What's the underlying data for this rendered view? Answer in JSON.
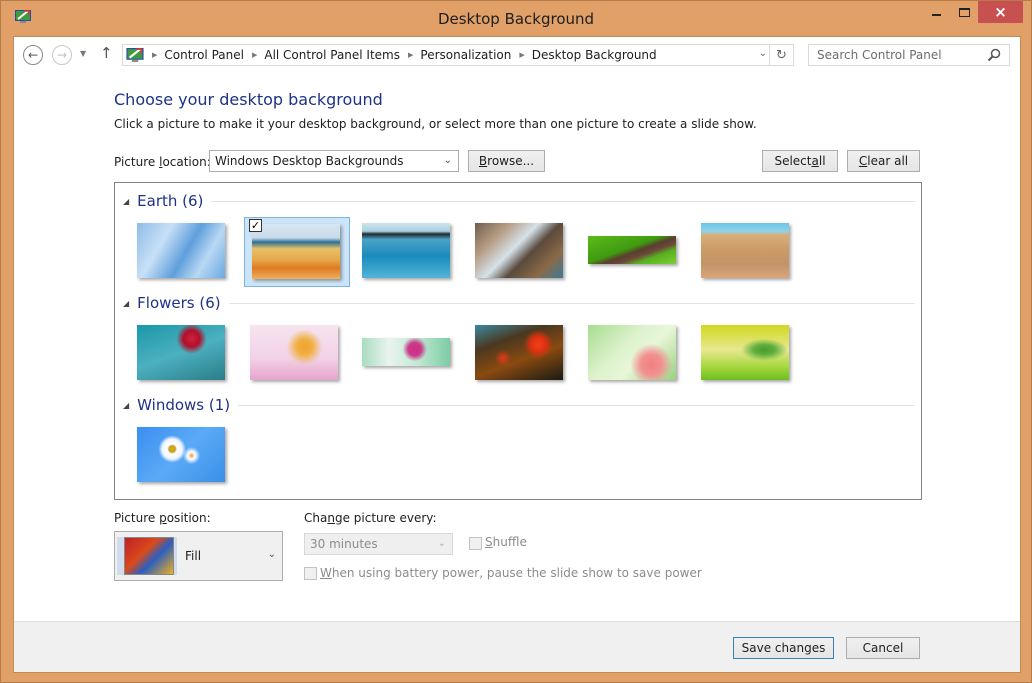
{
  "window": {
    "title": "Desktop Background",
    "controls": {
      "minimize": "minimize",
      "maximize": "maximize",
      "close": "×"
    },
    "accent_color": "#e0a068",
    "close_color": "#c75050"
  },
  "nav": {
    "back_icon": "←",
    "forward_icon": "→",
    "recent_icon": "▼",
    "up_icon": "↑",
    "breadcrumbs": [
      "Control Panel",
      "All Control Panel Items",
      "Personalization",
      "Desktop Background"
    ],
    "dropdown_icon": "⌄",
    "refresh_icon": "↻",
    "search_placeholder": "Search Control Panel",
    "search_icon": "⚲"
  },
  "content": {
    "heading": "Choose your desktop background",
    "subtext": "Click a picture to make it your desktop background, or select more than one picture to create a slide show.",
    "picture_location_label_pre": "Picture ",
    "picture_location_label_u": "l",
    "picture_location_label_post": "ocation:",
    "picture_location_value": "Windows Desktop Backgrounds",
    "browse_u": "B",
    "browse_rest": "rowse...",
    "select_all_pre": "Select ",
    "select_all_u": "a",
    "select_all_post": "ll",
    "clear_all_u": "C",
    "clear_all_rest": "lear all"
  },
  "groups": [
    {
      "title": "Earth (6)",
      "items": [
        {
          "name": "ice",
          "selected": false
        },
        {
          "name": "painted-hills",
          "selected": true
        },
        {
          "name": "ocean-islands",
          "selected": false
        },
        {
          "name": "rocky-shore",
          "selected": false
        },
        {
          "name": "green-path",
          "selected": false
        },
        {
          "name": "sand-dune",
          "selected": false
        }
      ]
    },
    {
      "title": "Flowers (6)",
      "items": [
        {
          "name": "red-flower-teal",
          "selected": false
        },
        {
          "name": "orange-flower-pink",
          "selected": false
        },
        {
          "name": "pink-flower-mint",
          "selected": false
        },
        {
          "name": "red-tulips-dark",
          "selected": false
        },
        {
          "name": "pink-lily-green",
          "selected": false
        },
        {
          "name": "green-leaves-yellow",
          "selected": false
        }
      ]
    },
    {
      "title": "Windows (1)",
      "items": [
        {
          "name": "daisies-blue",
          "selected": false
        }
      ]
    }
  ],
  "options": {
    "picture_position_pre": "Picture ",
    "picture_position_u": "p",
    "picture_position_post": "osition:",
    "picture_position_value": "Fill",
    "change_every_pre": "Cha",
    "change_every_u": "n",
    "change_every_post": "ge picture every:",
    "change_every_value": "30 minutes",
    "shuffle_u": "S",
    "shuffle_rest": "huffle",
    "shuffle_checked": false,
    "battery_u": "W",
    "battery_rest": "hen using battery power, pause the slide show to save power",
    "battery_checked": false
  },
  "footer": {
    "save": "Save changes",
    "cancel": "Cancel"
  }
}
